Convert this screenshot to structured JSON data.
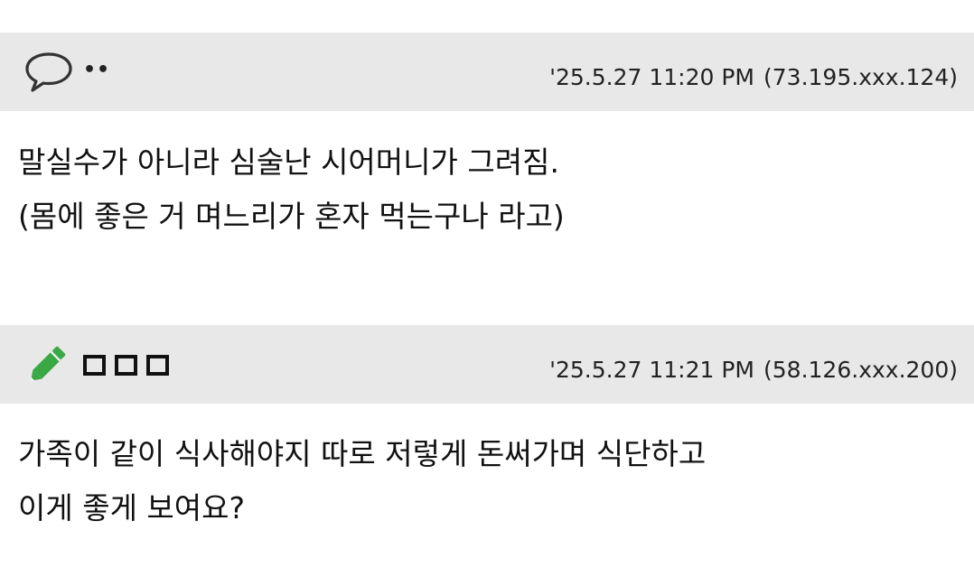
{
  "comments": [
    {
      "author_icon": "speech-bubble-icon",
      "author_name": "••",
      "timestamp": "'25.5.27 11:20 PM",
      "ip": "(73.195.xxx.124)",
      "lines": [
        "말실수가 아니라 심술난 시어머니가 그려짐.",
        "(몸에 좋은 거 며느리가 혼자 먹는구나 라고)"
      ]
    },
    {
      "author_icon": "pencil-icon",
      "author_name": "□□□",
      "timestamp": "'25.5.27 11:21 PM",
      "ip": "(58.126.xxx.200)",
      "lines": [
        "가족이 같이 식사해야지 따로 저렇게 돈써가며 식단하고",
        "이게 좋게 보여요?"
      ]
    }
  ],
  "colors": {
    "header_bg": "#e8e8e8",
    "pencil_green": "#3aa845"
  }
}
